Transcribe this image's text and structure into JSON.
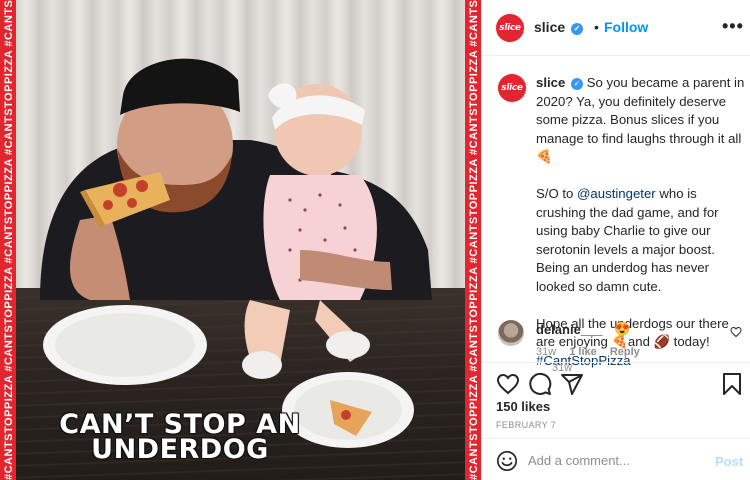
{
  "post_image": {
    "side_text": "#CANTSTOPPIZZA #CANTSTOPPIZZA #CANTSTOPPIZZA #CANTSTOPPIZZA #CANTSTOPPIZZA",
    "overlay_line1": "CAN’T STOP AN",
    "overlay_line2": "UNDERDOG",
    "colors": {
      "brand_red": "#e2252f"
    }
  },
  "header": {
    "brand_logo_text": "slice",
    "username": "slice",
    "separator": "•",
    "follow_label": "Follow",
    "more_label": "•••"
  },
  "caption": {
    "username": "slice",
    "para1": "So you became a parent in 2020? Ya, you definitely deserve some pizza. Bonus slices if you manage to find laughs through it all 🍕",
    "para2_prefix": "S/O to ",
    "mention": "@austingeter",
    "para2_suffix": " who is crushing the dad game, and for using baby Charlie to give our serotonin levels a major boost. Being an underdog has never looked so damn cute.",
    "para3": "Hope all the underdogs our there are enjoying 🍕and 🏈 today!",
    "hashtag": "#CantStopPizza",
    "time": "31w"
  },
  "comment": {
    "username": "delanie___",
    "text": "😍",
    "time": "31w",
    "likes": "1 like",
    "reply": "Reply"
  },
  "actions": {
    "likes": "150 likes",
    "date": "FEBRUARY 7"
  },
  "composer": {
    "placeholder": "Add a comment...",
    "post_label": "Post"
  }
}
